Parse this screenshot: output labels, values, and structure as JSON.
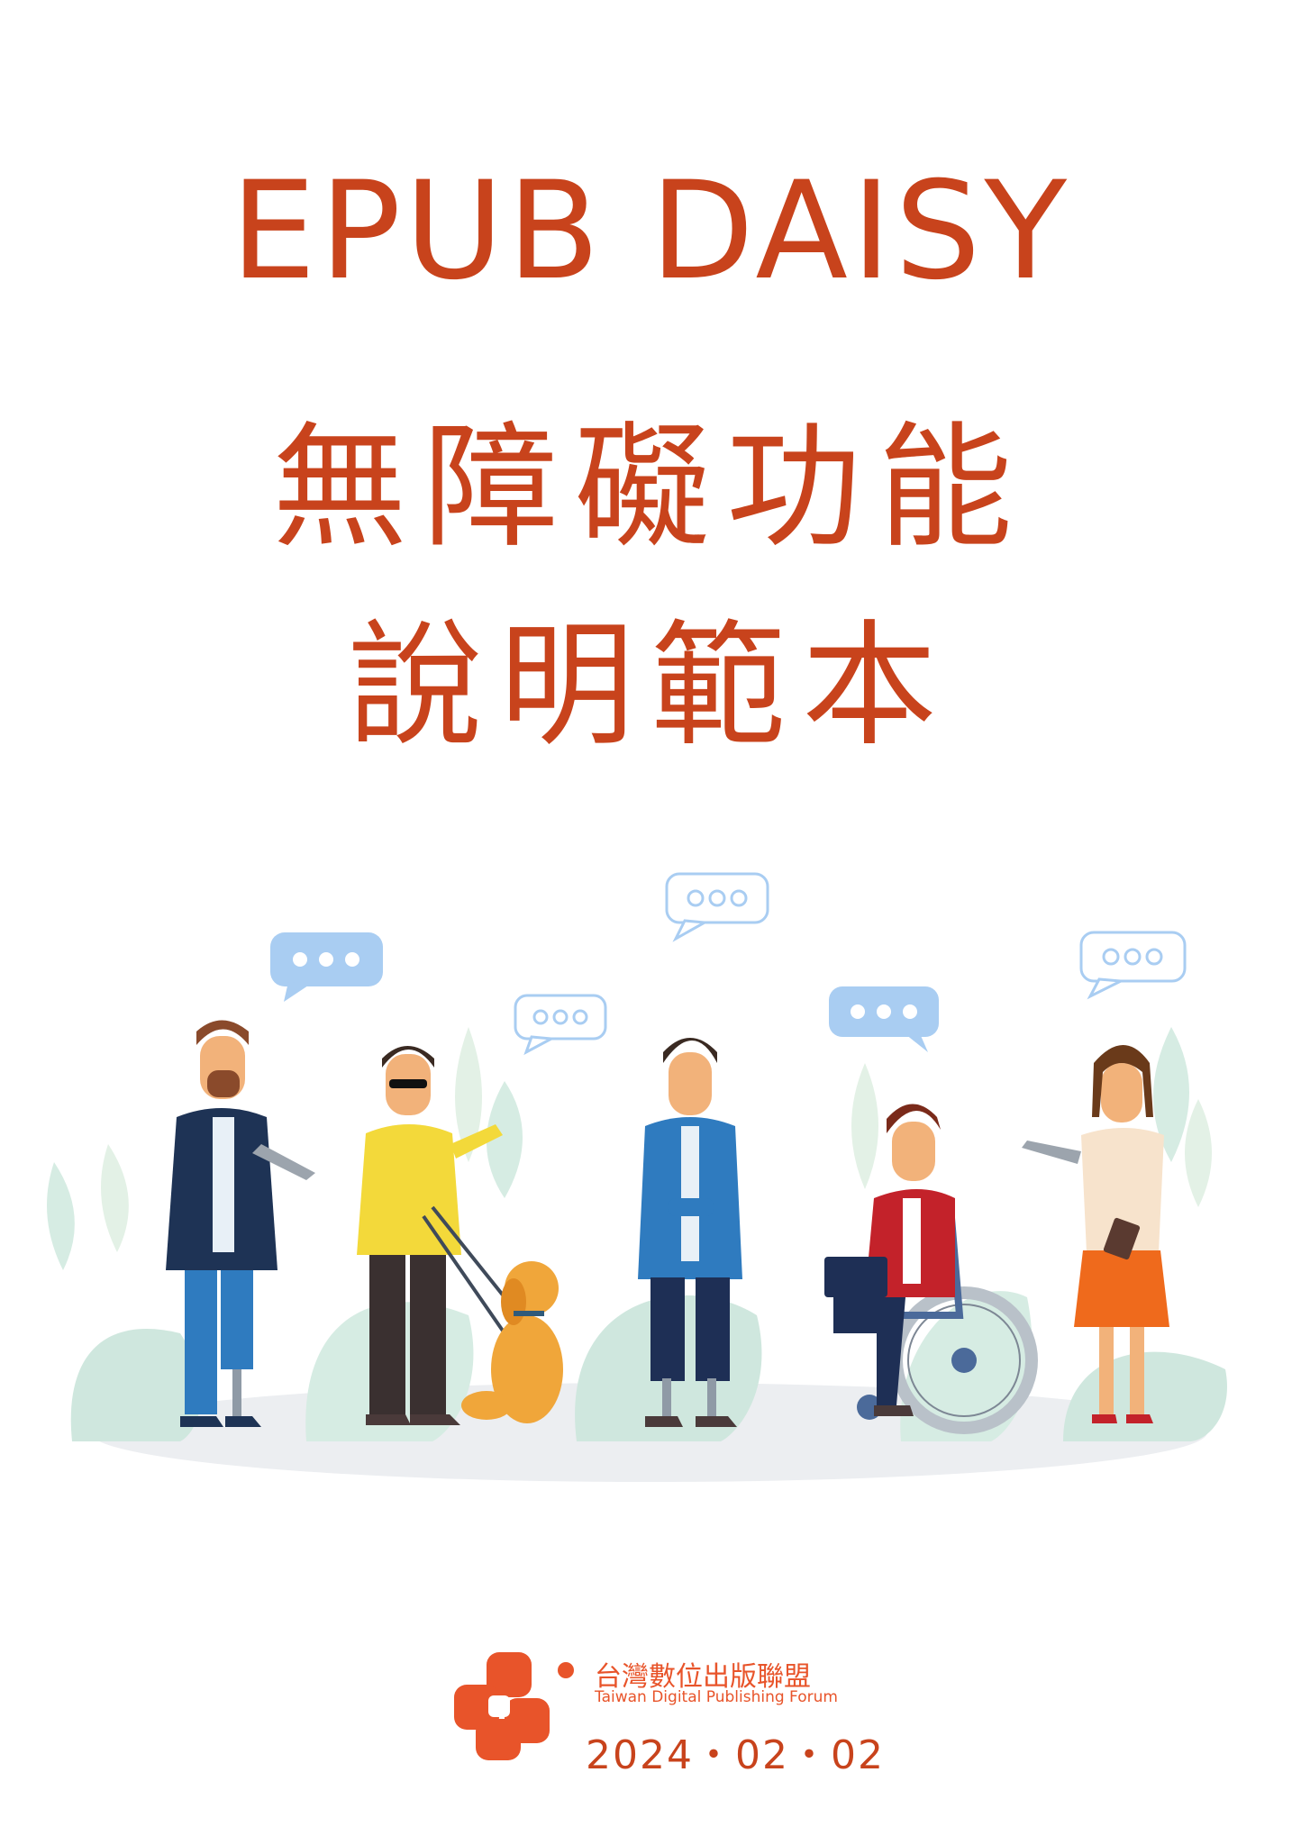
{
  "title": {
    "line1": "EPUB DAISY",
    "line2": "無障礙功能",
    "line3": "說明範本"
  },
  "footer": {
    "org_name": "台灣數位出版聯盟",
    "org_name_en": "Taiwan Digital Publishing Forum",
    "date": "2024・02・02"
  },
  "colors": {
    "title": "#c8431c",
    "logo": "#e8542a"
  }
}
